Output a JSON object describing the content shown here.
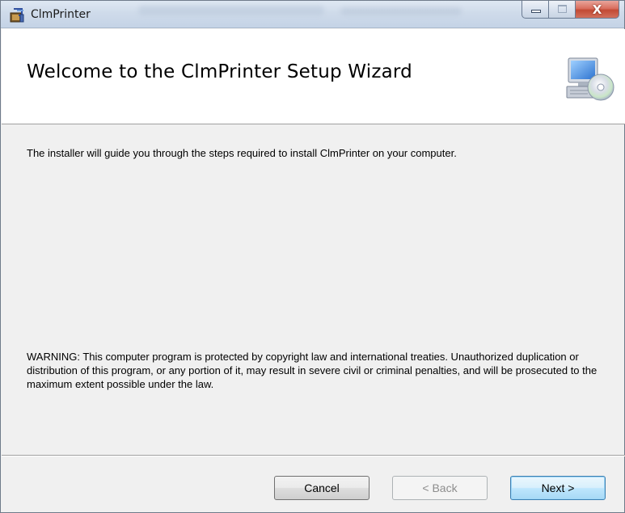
{
  "window": {
    "title": "ClmPrinter",
    "icons": {
      "app": "installer-box-icon",
      "banner": "computer-cd-icon"
    },
    "caption_buttons": {
      "minimize": "minimize-icon",
      "maximize": "maximize-icon",
      "close": "close-icon",
      "close_glyph": "X"
    }
  },
  "banner": {
    "title": "Welcome to the ClmPrinter Setup Wizard"
  },
  "body": {
    "intro": "The installer will guide you through the steps required to install ClmPrinter on your computer.",
    "warning": "WARNING: This computer program is protected by copyright law and international treaties. Unauthorized duplication or distribution of this program, or any portion of it, may result in severe civil or criminal penalties, and will be prosecuted to the maximum extent possible under the law."
  },
  "buttons": {
    "cancel": "Cancel",
    "back": "< Back",
    "next": "Next >",
    "back_enabled": false
  },
  "colors": {
    "titlebar": "#cfdbea",
    "close_button": "#c24a34",
    "dialog_bg": "#f0f0f0",
    "next_button_border": "#3c7fb1"
  }
}
